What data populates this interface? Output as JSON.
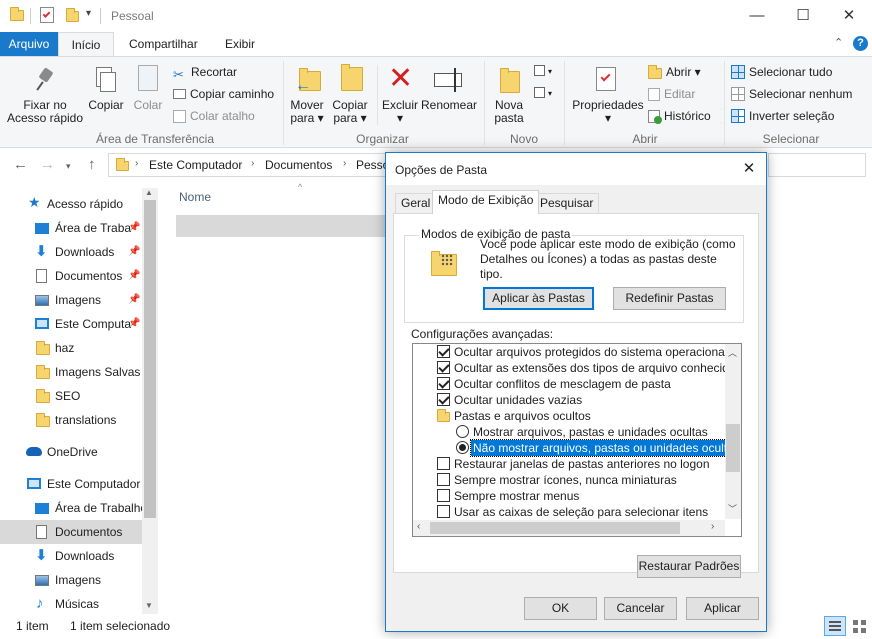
{
  "window": {
    "title": "Pessoal",
    "minimize": "—",
    "maximize": "☐",
    "close": "✕"
  },
  "tabs": [
    "Arquivo",
    "Início",
    "Compartilhar",
    "Exibir"
  ],
  "ribbon": {
    "clipboard": {
      "fixar": "Fixar no\nAcesso rápido",
      "copiar": "Copiar",
      "colar": "Colar",
      "recortar": "Recortar",
      "copiar_caminho": "Copiar caminho",
      "colar_atalho": "Colar atalho",
      "label": "Área de Transferência"
    },
    "organizar": {
      "mover": "Mover\npara ▾",
      "copiar_para": "Copiar\npara ▾",
      "excluir": "Excluir\n▾",
      "renomear": "Renomear",
      "label": "Organizar"
    },
    "novo": {
      "nova_pasta": "Nova\npasta",
      "label": "Novo"
    },
    "abrir": {
      "propriedades": "Propriedades\n▾",
      "abrir": "Abrir ▾",
      "editar": "Editar",
      "historico": "Histórico",
      "label": "Abrir"
    },
    "selecionar": {
      "tudo": "Selecionar tudo",
      "nenhum": "Selecionar nenhum",
      "inverter": "Inverter seleção",
      "label": "Selecionar"
    }
  },
  "address": {
    "crumbs": [
      "Este Computador",
      "Documentos",
      "Pesso"
    ]
  },
  "nav": {
    "items": [
      {
        "label": "Acesso rápido",
        "indent": 0,
        "pinned": false
      },
      {
        "label": "Área de Traba",
        "indent": 1,
        "pinned": true
      },
      {
        "label": "Downloads",
        "indent": 1,
        "pinned": true
      },
      {
        "label": "Documentos",
        "indent": 1,
        "pinned": true
      },
      {
        "label": "Imagens",
        "indent": 1,
        "pinned": true
      },
      {
        "label": "Este Computa",
        "indent": 1,
        "pinned": true
      },
      {
        "label": "haz",
        "indent": 1,
        "pinned": false
      },
      {
        "label": "Imagens Salvas",
        "indent": 1,
        "pinned": false
      },
      {
        "label": "SEO",
        "indent": 1,
        "pinned": false
      },
      {
        "label": "translations",
        "indent": 1,
        "pinned": false
      },
      {
        "label": "OneDrive",
        "indent": 0,
        "pinned": false
      },
      {
        "label": "Este Computador",
        "indent": 0,
        "pinned": false
      },
      {
        "label": "Área de Trabalho",
        "indent": 1,
        "pinned": false
      },
      {
        "label": "Documentos",
        "indent": 1,
        "pinned": false
      },
      {
        "label": "Downloads",
        "indent": 1,
        "pinned": false
      },
      {
        "label": "Imagens",
        "indent": 1,
        "pinned": false
      },
      {
        "label": "Músicas",
        "indent": 1,
        "pinned": false
      }
    ]
  },
  "content": {
    "column_name": "Nome"
  },
  "status": {
    "count": "1 item",
    "selected": "1 item selecionado"
  },
  "dialog": {
    "title": "Opções de Pasta",
    "tabs": [
      "Geral",
      "Modo de Exibição",
      "Pesquisar"
    ],
    "group_title": "Modos de exibição de pasta",
    "group_text": "Você pode aplicar este modo de exibição (como Detalhes ou Ícones) a todas as pastas deste tipo.",
    "apply_folders": "Aplicar às Pastas",
    "reset_folders": "Redefinir Pastas",
    "advanced_label": "Configurações avançadas:",
    "advanced_items": [
      {
        "type": "checkbox",
        "checked": true,
        "label": "Ocultar arquivos protegidos do sistema operacional (Reco",
        "indent": 0
      },
      {
        "type": "checkbox",
        "checked": true,
        "label": "Ocultar as extensões dos tipos de arquivo conhecidos",
        "indent": 0
      },
      {
        "type": "checkbox",
        "checked": true,
        "label": "Ocultar conflitos de mesclagem de pasta",
        "indent": 0
      },
      {
        "type": "checkbox",
        "checked": true,
        "label": "Ocultar unidades vazias",
        "indent": 0
      },
      {
        "type": "folder",
        "checked": false,
        "label": "Pastas e arquivos ocultos",
        "indent": 0
      },
      {
        "type": "radio",
        "checked": false,
        "label": "Mostrar arquivos, pastas e unidades ocultas",
        "indent": 1
      },
      {
        "type": "radio",
        "checked": true,
        "label": "Não mostrar arquivos, pastas ou unidades ocultas",
        "indent": 1,
        "selected": true
      },
      {
        "type": "checkbox",
        "checked": false,
        "label": "Restaurar janelas de pastas anteriores no logon",
        "indent": 0
      },
      {
        "type": "checkbox",
        "checked": false,
        "label": "Sempre mostrar ícones, nunca miniaturas",
        "indent": 0
      },
      {
        "type": "checkbox",
        "checked": false,
        "label": "Sempre mostrar menus",
        "indent": 0
      },
      {
        "type": "checkbox",
        "checked": false,
        "label": "Usar as caixas de seleção para selecionar itens",
        "indent": 0
      }
    ],
    "restore_defaults": "Restaurar Padrões",
    "ok": "OK",
    "cancel": "Cancelar",
    "apply": "Aplicar"
  },
  "colors": {
    "accent": "#1979ca",
    "ribbon_bg": "#f5f6f7",
    "selection": "#0078d7"
  }
}
